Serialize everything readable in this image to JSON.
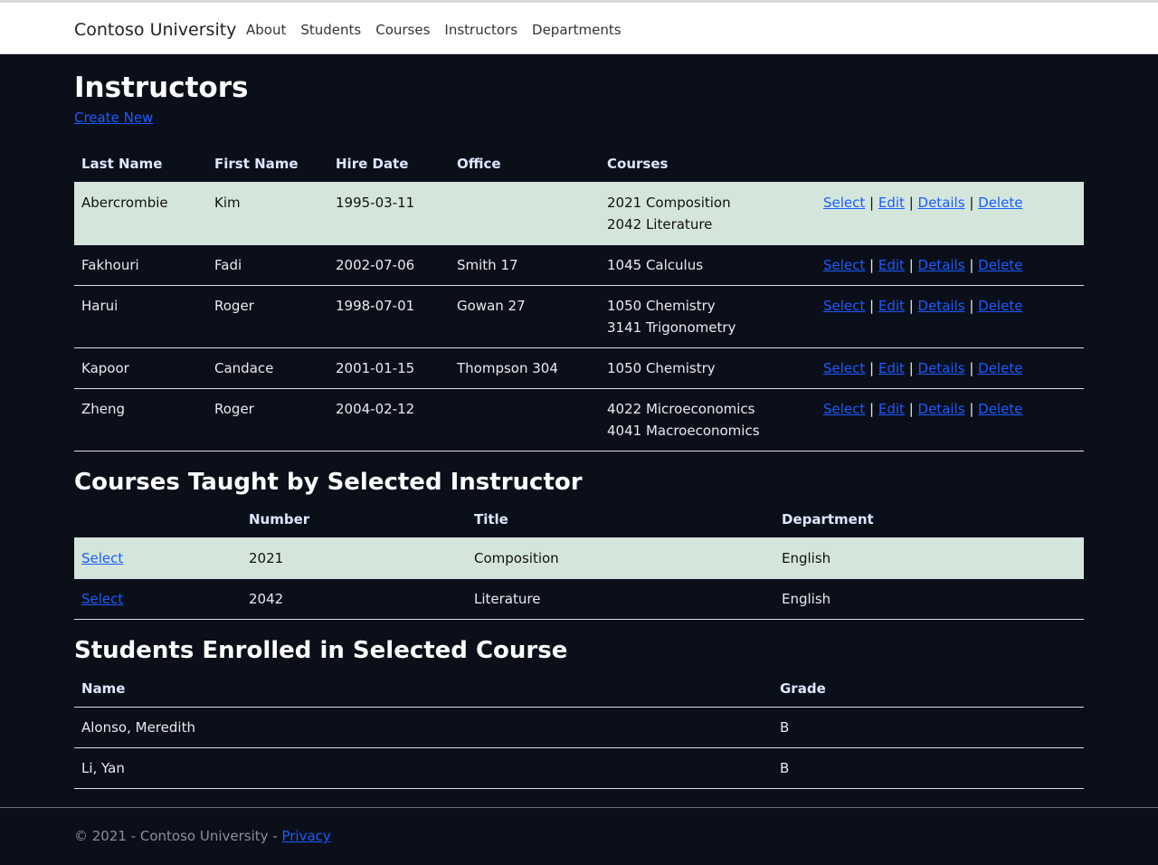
{
  "brand": "Contoso University",
  "nav": [
    "About",
    "Students",
    "Courses",
    "Instructors",
    "Departments"
  ],
  "page_title": "Instructors",
  "create_new": "Create New",
  "instructors": {
    "headers": [
      "Last Name",
      "First Name",
      "Hire Date",
      "Office",
      "Courses"
    ],
    "actions": [
      "Select",
      "Edit",
      "Details",
      "Delete"
    ],
    "rows": [
      {
        "last": "Abercrombie",
        "first": "Kim",
        "hire": "1995-03-11",
        "office": "",
        "courses": [
          "2021 Composition",
          "2042 Literature"
        ],
        "selected": true
      },
      {
        "last": "Fakhouri",
        "first": "Fadi",
        "hire": "2002-07-06",
        "office": "Smith 17",
        "courses": [
          "1045 Calculus"
        ],
        "selected": false
      },
      {
        "last": "Harui",
        "first": "Roger",
        "hire": "1998-07-01",
        "office": "Gowan 27",
        "courses": [
          "1050 Chemistry",
          "3141 Trigonometry"
        ],
        "selected": false
      },
      {
        "last": "Kapoor",
        "first": "Candace",
        "hire": "2001-01-15",
        "office": "Thompson 304",
        "courses": [
          "1050 Chemistry"
        ],
        "selected": false
      },
      {
        "last": "Zheng",
        "first": "Roger",
        "hire": "2004-02-12",
        "office": "",
        "courses": [
          "4022 Microeconomics",
          "4041 Macroeconomics"
        ],
        "selected": false
      }
    ]
  },
  "courses_title": "Courses Taught by Selected Instructor",
  "courses": {
    "headers": [
      "",
      "Number",
      "Title",
      "Department"
    ],
    "select_label": "Select",
    "rows": [
      {
        "number": "2021",
        "title": "Composition",
        "department": "English",
        "selected": true
      },
      {
        "number": "2042",
        "title": "Literature",
        "department": "English",
        "selected": false
      }
    ]
  },
  "students_title": "Students Enrolled in Selected Course",
  "students": {
    "headers": [
      "Name",
      "Grade"
    ],
    "rows": [
      {
        "name": "Alonso, Meredith",
        "grade": "B"
      },
      {
        "name": "Li, Yan",
        "grade": "B"
      }
    ]
  },
  "footer": {
    "text": "© 2021 - Contoso University - ",
    "privacy": "Privacy"
  }
}
